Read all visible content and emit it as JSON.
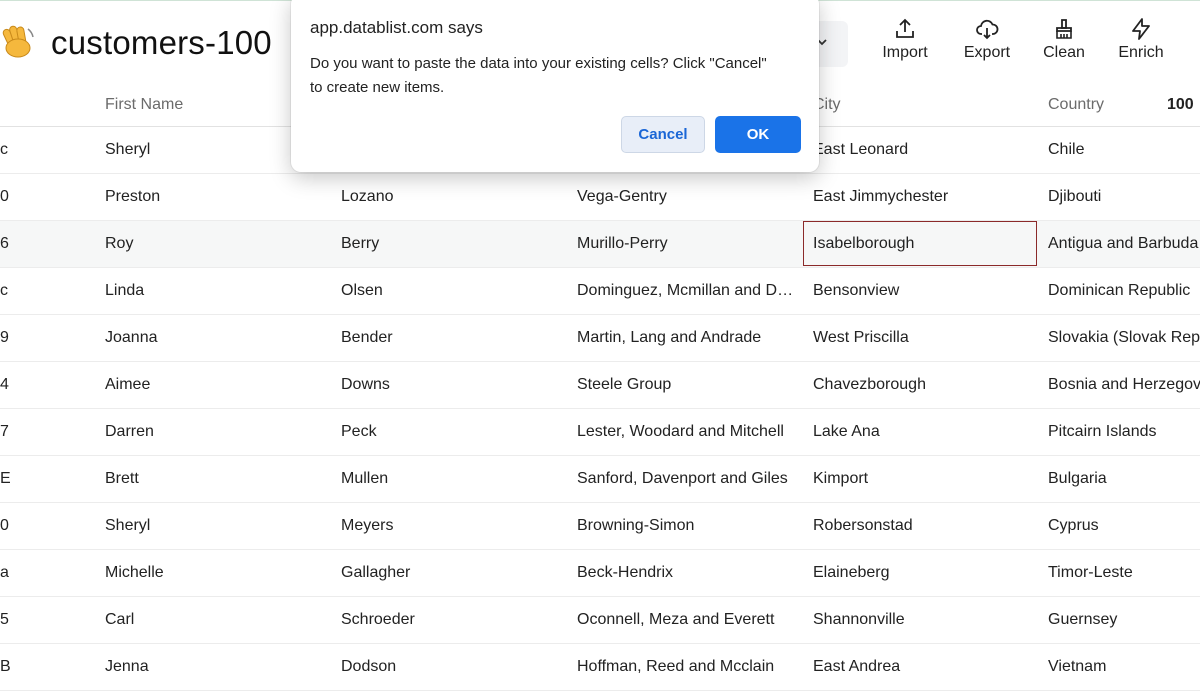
{
  "header": {
    "emoji": "👋",
    "title": "customers-100",
    "toolbar": [
      {
        "label": "Import",
        "icon": "upload-icon"
      },
      {
        "label": "Export",
        "icon": "cloud-download-icon"
      },
      {
        "label": "Clean",
        "icon": "broom-icon"
      },
      {
        "label": "Enrich",
        "icon": "lightning-icon"
      }
    ]
  },
  "columns": {
    "first_name": "First Name",
    "city": "City",
    "country": "Country",
    "count": "100"
  },
  "rows": [
    {
      "id": "c",
      "first": "Sheryl",
      "last": "",
      "company": "",
      "city": "East Leonard",
      "country": "Chile"
    },
    {
      "id": "0",
      "first": "Preston",
      "last": "Lozano",
      "company": "Vega-Gentry",
      "city": "East Jimmychester",
      "country": "Djibouti"
    },
    {
      "id": "6",
      "first": "Roy",
      "last": "Berry",
      "company": "Murillo-Perry",
      "city": "Isabelborough",
      "country": "Antigua and Barbuda"
    },
    {
      "id": "c",
      "first": "Linda",
      "last": "Olsen",
      "company": "Dominguez, Mcmillan and D…",
      "city": "Bensonview",
      "country": "Dominican Republic"
    },
    {
      "id": "9",
      "first": "Joanna",
      "last": "Bender",
      "company": "Martin, Lang and Andrade",
      "city": "West Priscilla",
      "country": "Slovakia (Slovak Rep"
    },
    {
      "id": "4",
      "first": "Aimee",
      "last": "Downs",
      "company": "Steele Group",
      "city": "Chavezborough",
      "country": "Bosnia and Herzegov"
    },
    {
      "id": "7",
      "first": "Darren",
      "last": "Peck",
      "company": "Lester, Woodard and Mitchell",
      "city": "Lake Ana",
      "country": "Pitcairn Islands"
    },
    {
      "id": "E",
      "first": "Brett",
      "last": "Mullen",
      "company": "Sanford, Davenport and Giles",
      "city": "Kimport",
      "country": "Bulgaria"
    },
    {
      "id": "0",
      "first": "Sheryl",
      "last": "Meyers",
      "company": "Browning-Simon",
      "city": "Robersonstad",
      "country": "Cyprus"
    },
    {
      "id": "a",
      "first": "Michelle",
      "last": "Gallagher",
      "company": "Beck-Hendrix",
      "city": "Elaineberg",
      "country": "Timor-Leste"
    },
    {
      "id": "5",
      "first": "Carl",
      "last": "Schroeder",
      "company": "Oconnell, Meza and Everett",
      "city": "Shannonville",
      "country": "Guernsey"
    },
    {
      "id": "B",
      "first": "Jenna",
      "last": "Dodson",
      "company": "Hoffman, Reed and Mcclain",
      "city": "East Andrea",
      "country": "Vietnam"
    }
  ],
  "dialog": {
    "title": "app.datablist.com says",
    "message": "Do you want to paste the data into your existing cells? Click \"Cancel\" to create new items.",
    "cancel_label": "Cancel",
    "ok_label": "OK"
  },
  "colors": {
    "accent": "#1a73e8",
    "selected_border": "#8b2a2a"
  }
}
